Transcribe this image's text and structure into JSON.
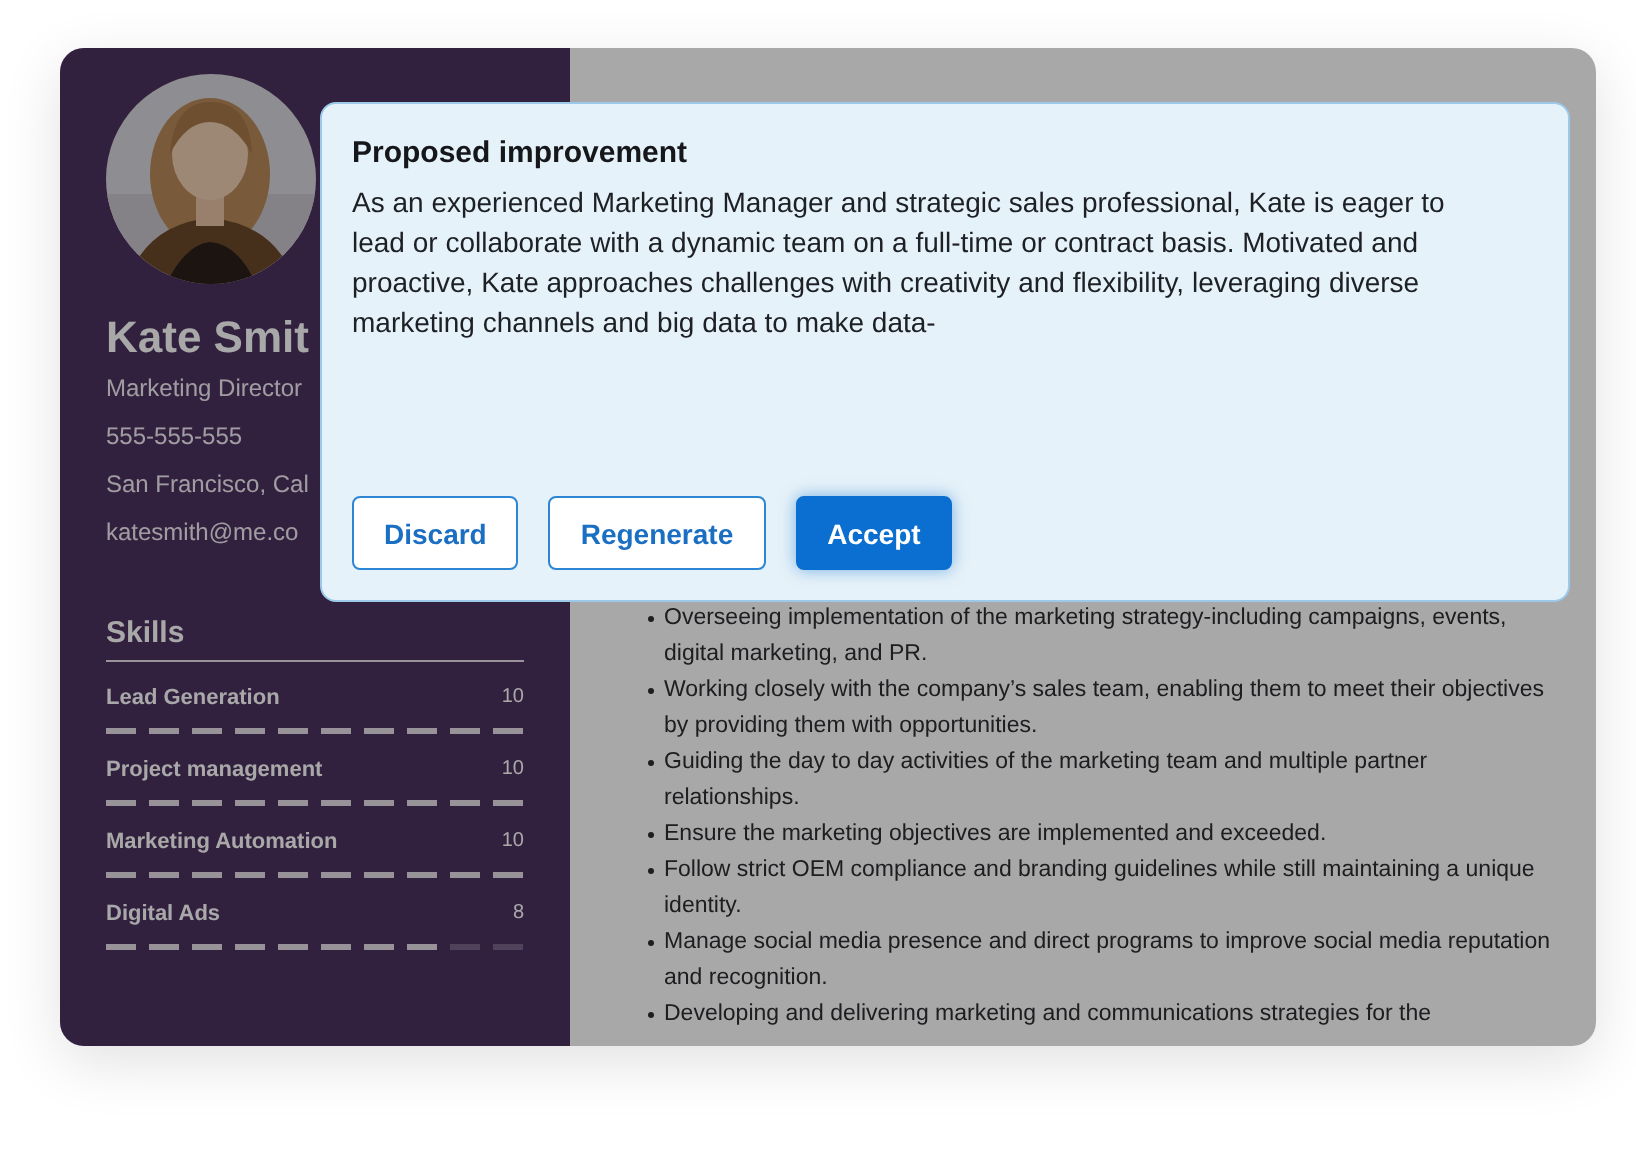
{
  "profile": {
    "name": "Kate Smit",
    "details": [
      "Marketing Director",
      "555-555-555",
      "San Francisco, Cal",
      "katesmith@me.co"
    ]
  },
  "skills": {
    "title": "Skills",
    "items": [
      {
        "name": "Lead Generation",
        "score": "10",
        "level": 1
      },
      {
        "name": "Project management",
        "score": "10",
        "level": 1
      },
      {
        "name": "Marketing Automation",
        "score": "10",
        "level": 1
      },
      {
        "name": "Digital Ads",
        "score": "8",
        "level": 0.8
      }
    ]
  },
  "experience": {
    "bullets": [
      "Overseeing implementation of the marketing strategy-including campaigns, events, digital marketing, and PR.",
      "Working closely with the company’s sales team, enabling them to meet their objectives by providing them with opportunities.",
      "Guiding the day to day activities of the marketing team and multiple partner relationships.",
      "Ensure the marketing objectives are implemented and exceeded.",
      "Follow strict OEM compliance and branding guidelines while still maintaining a unique identity.",
      "Manage social media presence and direct programs to improve social media reputation and recognition.",
      "Developing and delivering marketing and communications strategies for the"
    ]
  },
  "dialog": {
    "title": "Proposed improvement",
    "text": "As an experienced Marketing Manager and strategic sales professional, Kate is eager to lead or collaborate with a dynamic team on a full-time or contract basis. Motivated and proactive, Kate approaches challenges with creativity and flexibility, leveraging diverse marketing channels and big data to make data-",
    "buttons": [
      {
        "label": "Discard",
        "kind": "secondary"
      },
      {
        "label": "Regenerate",
        "kind": "secondary"
      },
      {
        "label": "Accept",
        "kind": "primary"
      }
    ]
  }
}
